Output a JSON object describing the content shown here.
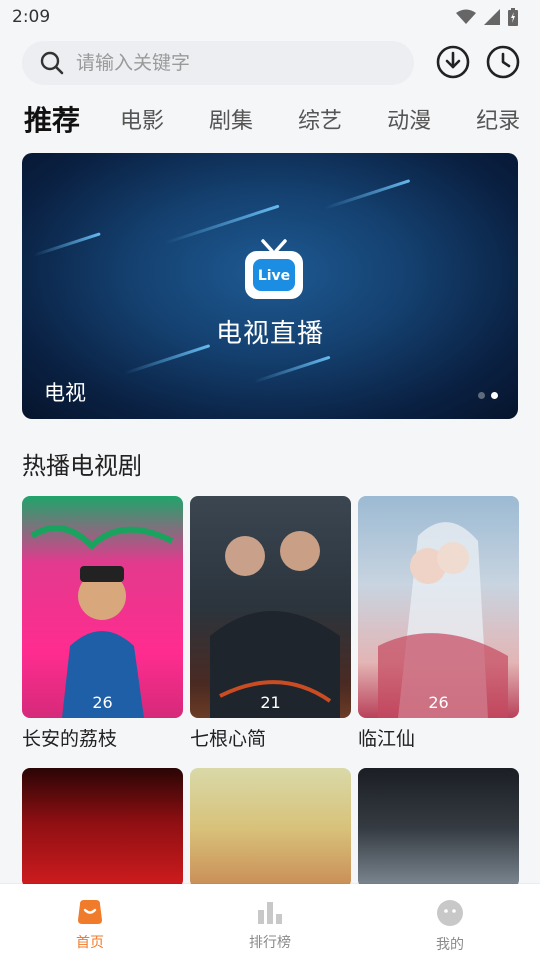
{
  "status_bar": {
    "time": "2:09"
  },
  "search": {
    "placeholder": "请输入关键字"
  },
  "tabs": [
    {
      "label": "推荐",
      "active": true
    },
    {
      "label": "电影"
    },
    {
      "label": "剧集"
    },
    {
      "label": "综艺"
    },
    {
      "label": "动漫"
    },
    {
      "label": "纪录"
    }
  ],
  "banner": {
    "logo_text": "Live",
    "heading": "电视直播",
    "caption": "电视",
    "page_count": 2,
    "active_page": 2
  },
  "section": {
    "title": "热播电视剧"
  },
  "shows": [
    {
      "title": "长安的荔枝",
      "episodes": "26"
    },
    {
      "title": "七根心简",
      "episodes": "21"
    },
    {
      "title": "临江仙",
      "episodes": "26"
    }
  ],
  "bottom_nav": [
    {
      "label": "首页",
      "active": true
    },
    {
      "label": "排行榜"
    },
    {
      "label": "我的"
    }
  ],
  "colors": {
    "accent": "#f07b2b",
    "inactive_nav": "#c8c8c8"
  }
}
